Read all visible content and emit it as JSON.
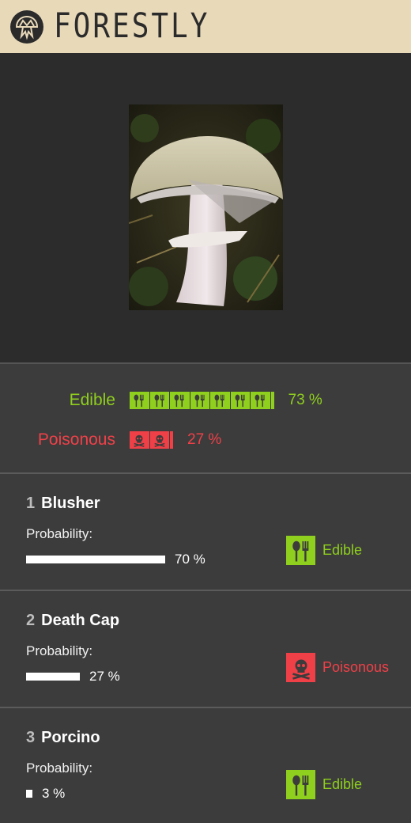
{
  "app": {
    "brand": "FORESTLY"
  },
  "colors": {
    "header_bg": "#e8d9b9",
    "edible": "#8fcf1d",
    "poisonous": "#ef4048",
    "panel_bg": "#3c3c3c"
  },
  "summary": {
    "edible": {
      "label": "Edible",
      "percent_text": "73 %",
      "percent": 73,
      "icon": "fork-spoon-icon"
    },
    "poisonous": {
      "label": "Poisonous",
      "percent_text": "27 %",
      "percent": 27,
      "icon": "skull-crossbones-icon"
    }
  },
  "results": [
    {
      "rank": "1",
      "name": "Blusher",
      "probability_label": "Probability:",
      "probability_text": "70 %",
      "probability": 0.7,
      "verdict": "Edible",
      "verdict_type": "edible"
    },
    {
      "rank": "2",
      "name": "Death Cap",
      "probability_label": "Probability:",
      "probability_text": "27 %",
      "probability": 0.27,
      "verdict": "Poisonous",
      "verdict_type": "poisonous"
    },
    {
      "rank": "3",
      "name": "Porcino",
      "probability_label": "Probability:",
      "probability_text": "3 %",
      "probability": 0.03,
      "verdict": "Edible",
      "verdict_type": "edible"
    }
  ]
}
